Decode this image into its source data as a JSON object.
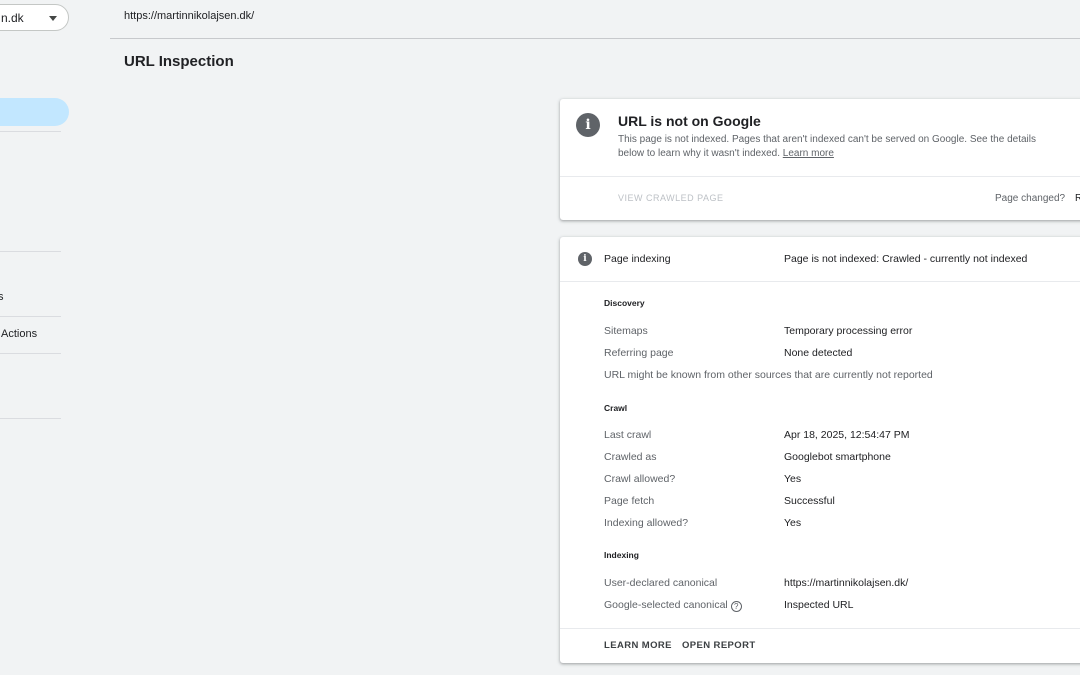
{
  "sidebar": {
    "property_label": "n.dk",
    "nav_items": [
      {
        "label": "s"
      },
      {
        "label": "Actions"
      }
    ]
  },
  "header": {
    "url": "https://martinnikolajsen.dk/",
    "page_title": "URL Inspection"
  },
  "status": {
    "title": "URL is not on Google",
    "description": "This page is not indexed. Pages that aren't indexed can't be served on Google. See the details below to learn why it wasn't indexed.",
    "learn_more": "Learn more",
    "view_crawled": "VIEW CRAWLED PAGE",
    "page_changed": "Page changed?",
    "request_cut": "R"
  },
  "indexing": {
    "label": "Page indexing",
    "value": "Page is not indexed: Crawled - currently not indexed",
    "sections": {
      "discovery": {
        "title": "Discovery",
        "rows": [
          {
            "label": "Sitemaps",
            "value": "Temporary processing error"
          },
          {
            "label": "Referring page",
            "value": "None detected"
          }
        ],
        "note": "URL might be known from other sources that are currently not reported"
      },
      "crawl": {
        "title": "Crawl",
        "rows": [
          {
            "label": "Last crawl",
            "value": "Apr 18, 2025, 12:54:47 PM"
          },
          {
            "label": "Crawled as",
            "value": "Googlebot smartphone"
          },
          {
            "label": "Crawl allowed?",
            "value": "Yes"
          },
          {
            "label": "Page fetch",
            "value": "Successful"
          },
          {
            "label": "Indexing allowed?",
            "value": "Yes"
          }
        ]
      },
      "indexing": {
        "title": "Indexing",
        "rows": [
          {
            "label": "User-declared canonical",
            "value": "https://martinnikolajsen.dk/"
          },
          {
            "label": "Google-selected canonical",
            "value": "Inspected URL"
          }
        ]
      }
    },
    "footer": {
      "learn_more": "LEARN MORE",
      "open_report": "OPEN REPORT"
    }
  },
  "colors": {
    "background": "#f1f3f4",
    "active_nav": "#c2e7ff",
    "icon": "#5f6368"
  }
}
